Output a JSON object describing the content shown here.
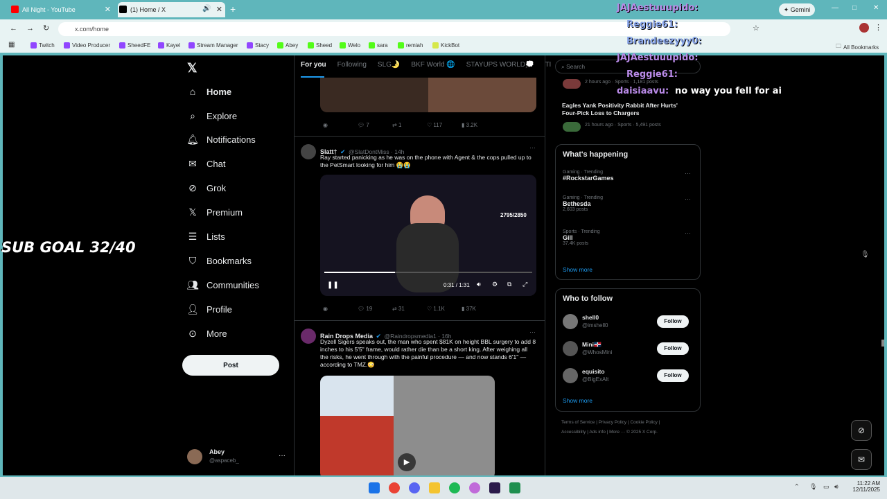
{
  "browser": {
    "tabs": [
      {
        "title": "All Night - YouTube"
      },
      {
        "title": "(1) Home / X"
      }
    ],
    "url": "x.com/home",
    "gemini": "Gemini",
    "bookmarks": [
      "Twitch",
      "Video Producer",
      "SheedFE",
      "Kayel",
      "Stream Manager",
      "Stacy",
      "Abey",
      "Sheed",
      "Welo",
      "sara",
      "remiah",
      "KickBot"
    ],
    "all_bookmarks": "All Bookmarks"
  },
  "sidebar": {
    "items": [
      {
        "label": "Home"
      },
      {
        "label": "Explore"
      },
      {
        "label": "Notifications"
      },
      {
        "label": "Chat"
      },
      {
        "label": "Grok"
      },
      {
        "label": "Premium"
      },
      {
        "label": "Lists"
      },
      {
        "label": "Bookmarks"
      },
      {
        "label": "Communities"
      },
      {
        "label": "Profile"
      },
      {
        "label": "More"
      }
    ],
    "post_label": "Post",
    "account": {
      "name": "Abey",
      "handle": "@aspaceb_"
    }
  },
  "feed": {
    "tabs": [
      "For you",
      "Following",
      "SLG🌛",
      "BKF World 🌐",
      "STAYUPS WORLD💭",
      "TI"
    ],
    "top_actions": {
      "replies": "7",
      "reposts": "1",
      "likes": "117",
      "views": "3.2K"
    },
    "tweet1": {
      "name": "Slatt†",
      "handle": "@SlatDontMiss · 14h",
      "text": "Ray started panicking as he was on the phone with Agent & the cops pulled up to the PetSmart looking for him 😭😭",
      "video_overlay": "2795/2850",
      "video_time": "0:31 / 1:31",
      "video_progress": 0.34,
      "actions": {
        "replies": "19",
        "reposts": "31",
        "likes": "1.1K",
        "views": "37K"
      }
    },
    "tweet2": {
      "name": "Rain Drops Media",
      "handle": "@Raindropsmedia1 · 16h",
      "text": "Dyzell Sigers speaks out, the man who spent $81K on height BBL surgery to add 8 inches to his 5'5\" frame, would rather die than be a short king. After weighing all the risks, he went through with the painful procedure — and now stands 6'1\" — according to TMZ.😳"
    }
  },
  "right": {
    "search_placeholder": "Search",
    "top_meta": "2 hours ago · Sports · 1,181 posts",
    "top_headline": "Eagles Yank Positivity Rabbit After Hurts' Four-Pick Loss to Chargers",
    "top_meta2": "21 hours ago · Sports · 5,491 posts",
    "happening_title": "What's happening",
    "trends": [
      {
        "category": "Gaming · Trending",
        "name": "#RockstarGames",
        "posts": ""
      },
      {
        "category": "Gaming · Trending",
        "name": "Bethesda",
        "posts": "2,603 posts"
      },
      {
        "category": "Sports · Trending",
        "name": "Gill",
        "posts": "37.4K posts"
      }
    ],
    "show_more": "Show more",
    "who_title": "Who to follow",
    "follow": [
      {
        "name": "shell0",
        "handle": "@imshell0"
      },
      {
        "name": "Mini🇩🇴",
        "handle": "@WhosMini"
      },
      {
        "name": "equisito",
        "handle": "@BigExAlt"
      }
    ],
    "follow_label": "Follow",
    "footer1": "Terms of Service | Privacy Policy | Cookie Policy |",
    "footer2": "Accessibility | Ads info | More ··· © 2025 X Corp."
  },
  "overlay": {
    "sub_goal": "SUB GOAL 32/40",
    "chat": [
      {
        "user": "JAJAestuuupido:",
        "msg": ""
      },
      {
        "user": "Reggie61:",
        "msg": ""
      },
      {
        "user": "Brandeezyyy0:",
        "msg": ""
      },
      {
        "user": "JAJAestuuupido:",
        "msg": ""
      },
      {
        "user": "Reggie61:",
        "msg": ""
      },
      {
        "user": "daisiaavu:",
        "msg": "no way you fell for ai"
      }
    ]
  },
  "system": {
    "time": "11:22 AM",
    "date": "12/11/2025"
  }
}
